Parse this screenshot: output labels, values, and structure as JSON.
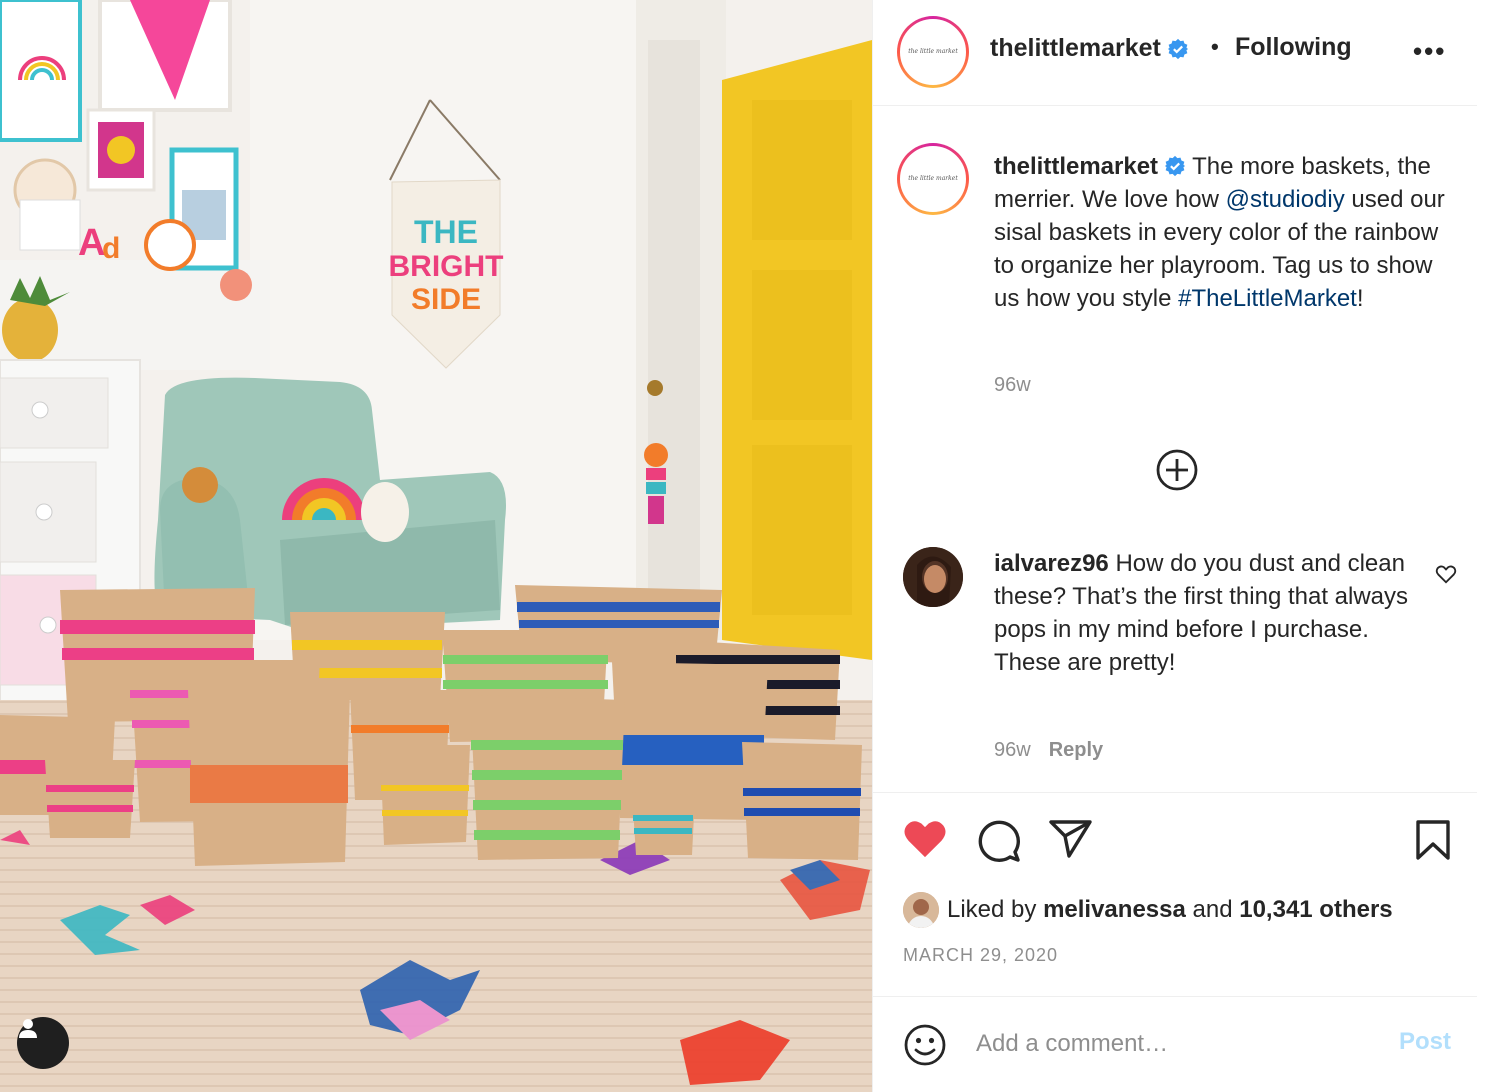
{
  "post": {
    "username": "thelittlemarket",
    "separator": "•",
    "follow_status": "Following",
    "more_label": "•••",
    "avatar_logo_text": "the little market",
    "colors": {
      "verified": "#3897f0",
      "heart": "#ed4956",
      "link": "#00376b",
      "door": "#f2c624",
      "post_disabled": "#b2dffc"
    }
  },
  "photo": {
    "banner_lines": [
      "THE",
      "BRIGHT",
      "SIDE"
    ]
  },
  "caption": {
    "username": "thelittlemarket",
    "text_1": "The more baskets, the merrier. We love how ",
    "mention": "@studiodiy",
    "text_2": " used our sisal baskets in every color of the rainbow to organize her playroom. Tag us to show us how you style ",
    "hashtag": "#TheLittleMarket",
    "text_3": "!",
    "time": "96w"
  },
  "comment": {
    "username": "ialvarez96",
    "text": "How do you dust and clean these? That’s the first thing that always pops in my mind before I purchase. These are pretty!",
    "time": "96w",
    "reply_label": "Reply"
  },
  "actions": {
    "liked_prefix": "Liked by",
    "liked_user": "melivanessa",
    "liked_mid": "and",
    "liked_count": "10,341 others",
    "date": "MARCH 29, 2020"
  },
  "composer": {
    "placeholder": "Add a comment…",
    "post_label": "Post"
  },
  "icons": [
    "verified-icon",
    "more-options-icon",
    "load-more-icon",
    "heart-icon",
    "comment-icon",
    "share-icon",
    "bookmark-icon",
    "emoji-icon",
    "tag-user-icon"
  ]
}
